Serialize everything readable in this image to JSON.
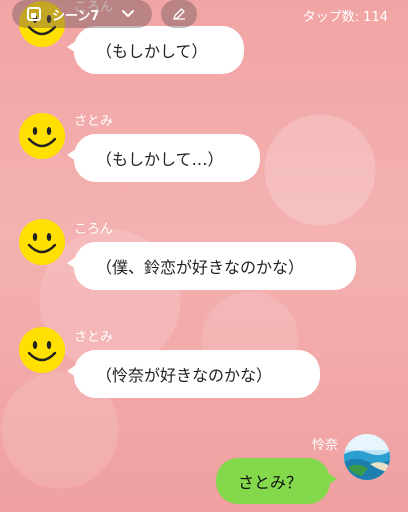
{
  "topbar": {
    "scene_label": "シーン7",
    "tap_count_label": "タップ数: 114",
    "icons": [
      "scene-icon",
      "chevron-down-icon",
      "pencil-icon"
    ]
  },
  "messages": [
    {
      "sender": "ころん",
      "text": "（もしかして）",
      "side": "left"
    },
    {
      "sender": "さとみ",
      "text": "（もしかして…）",
      "side": "left"
    },
    {
      "sender": "ころん",
      "text": "（僕、鈴恋が好きなのかな）",
      "side": "left"
    },
    {
      "sender": "さとみ",
      "text": "（怜奈が好きなのかな）",
      "side": "left"
    },
    {
      "sender": "怜奈",
      "text": "さとみ？",
      "side": "right"
    }
  ],
  "colors": {
    "background": "#f2a7a7",
    "bubble_left": "#ffffff",
    "bubble_right": "#84d84c",
    "smiley": "#ffe000"
  }
}
